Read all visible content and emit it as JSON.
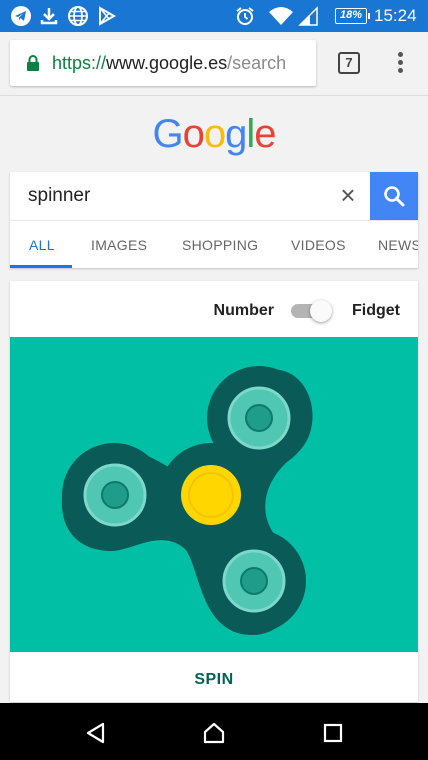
{
  "status_bar": {
    "icons": [
      "telegram-icon",
      "download-icon",
      "globe-icon",
      "play-store-icon",
      "alarm-icon",
      "wifi-icon",
      "signal-icon"
    ],
    "battery": "18%",
    "time": "15:24"
  },
  "browser": {
    "url_scheme": "https://",
    "url_host": "www.google.es",
    "url_path": "/search",
    "tab_count": "7"
  },
  "google": {
    "logo_letters": [
      "G",
      "o",
      "o",
      "g",
      "l",
      "e"
    ],
    "logo_colors": [
      "#4285f4",
      "#ea4335",
      "#fbbc05",
      "#4285f4",
      "#34a853",
      "#ea4335"
    ],
    "query": "spinner",
    "clear_symbol": "×",
    "tabs": [
      {
        "label": "ALL",
        "active": true
      },
      {
        "label": "IMAGES",
        "active": false
      },
      {
        "label": "SHOPPING",
        "active": false
      },
      {
        "label": "VIDEOS",
        "active": false
      },
      {
        "label": "NEWS",
        "active": false
      }
    ]
  },
  "spinner_card": {
    "toggle_left_label": "Number",
    "toggle_right_label": "Fidget",
    "toggle_on": true,
    "spin_label": "SPIN",
    "colors": {
      "background": "#00bfa5",
      "body": "#0a5a58",
      "bearing": "#4fc7b3",
      "center": "#ffd600"
    }
  },
  "nav_bar": {
    "icons": [
      "back-icon",
      "home-icon",
      "recents-icon"
    ]
  }
}
